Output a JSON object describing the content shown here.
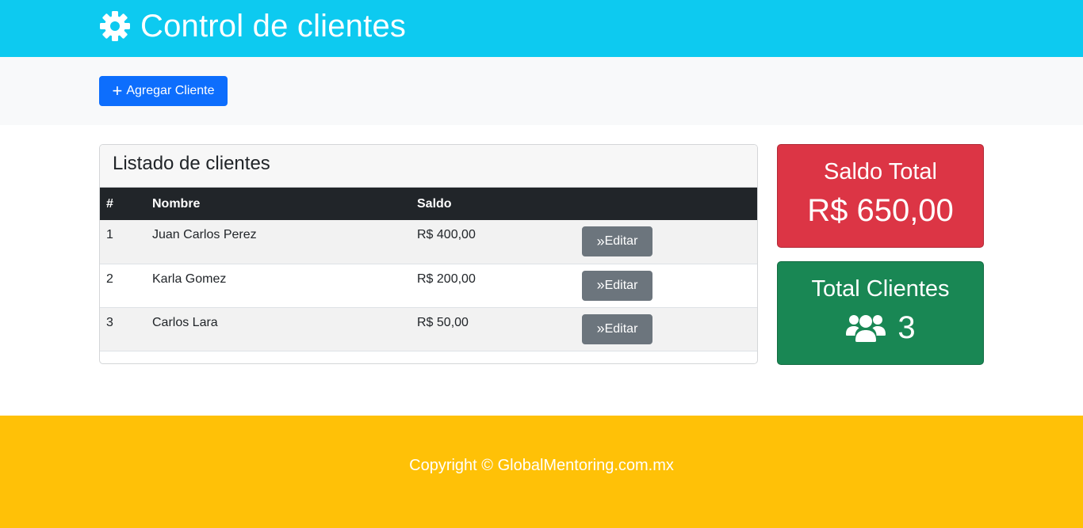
{
  "header": {
    "title": "Control de clientes",
    "icon": "gear-icon"
  },
  "actions": {
    "add_label": "Agregar Cliente",
    "add_icon": "plus-icon"
  },
  "clients_card": {
    "title": "Listado de clientes",
    "columns": [
      "#",
      "Nombre",
      "Saldo",
      ""
    ],
    "rows": [
      {
        "num": "1",
        "name": "Juan Carlos Perez",
        "saldo": "R$ 400,00",
        "edit_label": "Editar"
      },
      {
        "num": "2",
        "name": "Karla Gomez",
        "saldo": "R$ 200,00",
        "edit_label": "Editar"
      },
      {
        "num": "3",
        "name": "Carlos Lara",
        "saldo": "R$ 50,00",
        "edit_label": "Editar"
      }
    ]
  },
  "stats": {
    "saldo_title": "Saldo Total",
    "saldo_value": "R$ 650,00",
    "clientes_title": "Total Clientes",
    "clientes_value": "3",
    "clientes_icon": "users-icon"
  },
  "footer": {
    "text": "Copyright © GlobalMentoring.com.mx"
  },
  "colors": {
    "header": "#0dcaf0",
    "primary": "#0d6efd",
    "secondary": "#6c757d",
    "danger": "#dc3545",
    "success": "#198754",
    "warning": "#ffc107",
    "dark": "#212529"
  }
}
